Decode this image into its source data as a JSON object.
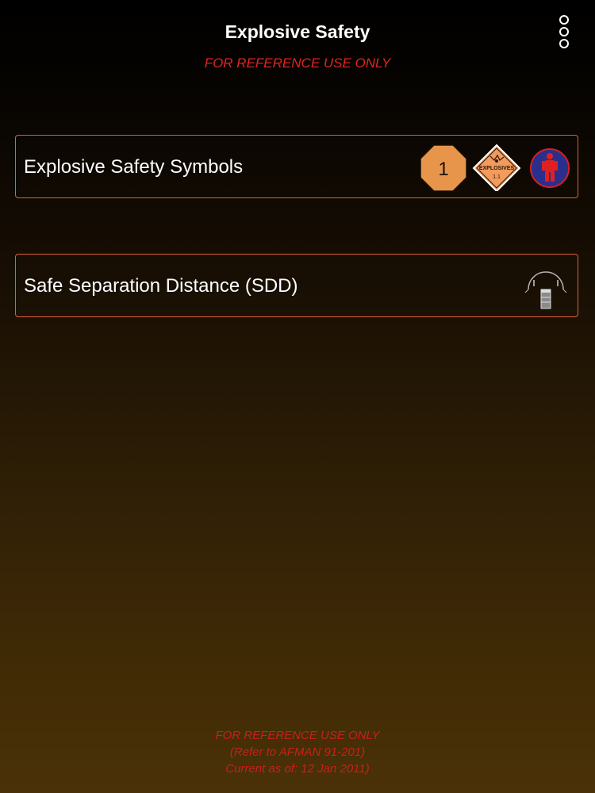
{
  "header": {
    "title": "Explosive Safety",
    "disclaimer": "FOR REFERENCE USE ONLY",
    "menu_icon": "more-vertical-icon"
  },
  "menu": {
    "items": [
      {
        "label": "Explosive Safety Symbols",
        "icons": [
          {
            "name": "fire-division-1-octagon-icon",
            "text": "1",
            "color": "#e8954c"
          },
          {
            "name": "explosives-1-1-placard-icon",
            "text": "EXPLOSIVES",
            "subtext": "1.1",
            "color": "#f39a5d"
          },
          {
            "name": "protective-clothing-person-icon",
            "color": "#2a2f8c"
          }
        ]
      },
      {
        "label": "Safe Separation Distance (SDD)",
        "icons": [
          {
            "name": "separation-distance-radius-icon"
          }
        ]
      }
    ]
  },
  "footer": {
    "line1": "FOR REFERENCE USE ONLY",
    "line2": "(Refer to AFMAN 91-201)",
    "line3": "Current as of: 12 Jan 2011)"
  },
  "colors": {
    "border": "#d9623a",
    "disclaimer_red": "#e0251f",
    "title_white": "#ffffff"
  }
}
